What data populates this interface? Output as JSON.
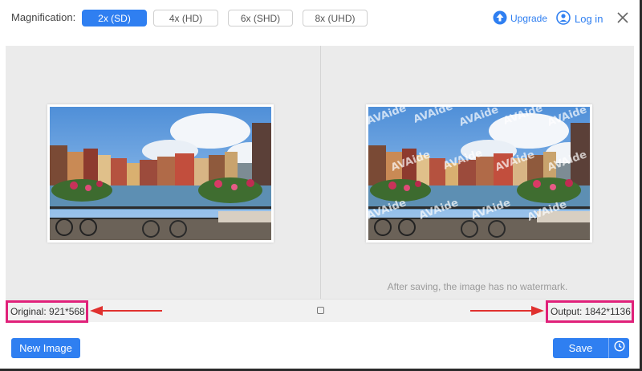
{
  "toolbar": {
    "magnification_label": "Magnification:",
    "options": [
      {
        "label": "2x (SD)",
        "active": true
      },
      {
        "label": "4x (HD)",
        "active": false
      },
      {
        "label": "6x (SHD)",
        "active": false
      },
      {
        "label": "8x (UHD)",
        "active": false
      }
    ],
    "upgrade_label": "Upgrade",
    "login_label": "Log in"
  },
  "preview": {
    "watermark_text": "AVAide",
    "no_watermark_note": "After saving, the image has no watermark."
  },
  "info": {
    "original": "Original: 921*568",
    "output": "Output: 1842*1136"
  },
  "actions": {
    "new_image_label": "New Image",
    "save_label": "Save"
  },
  "colors": {
    "accent": "#2f7ff1",
    "highlight": "#e0217a",
    "arrow": "#e0312f"
  }
}
